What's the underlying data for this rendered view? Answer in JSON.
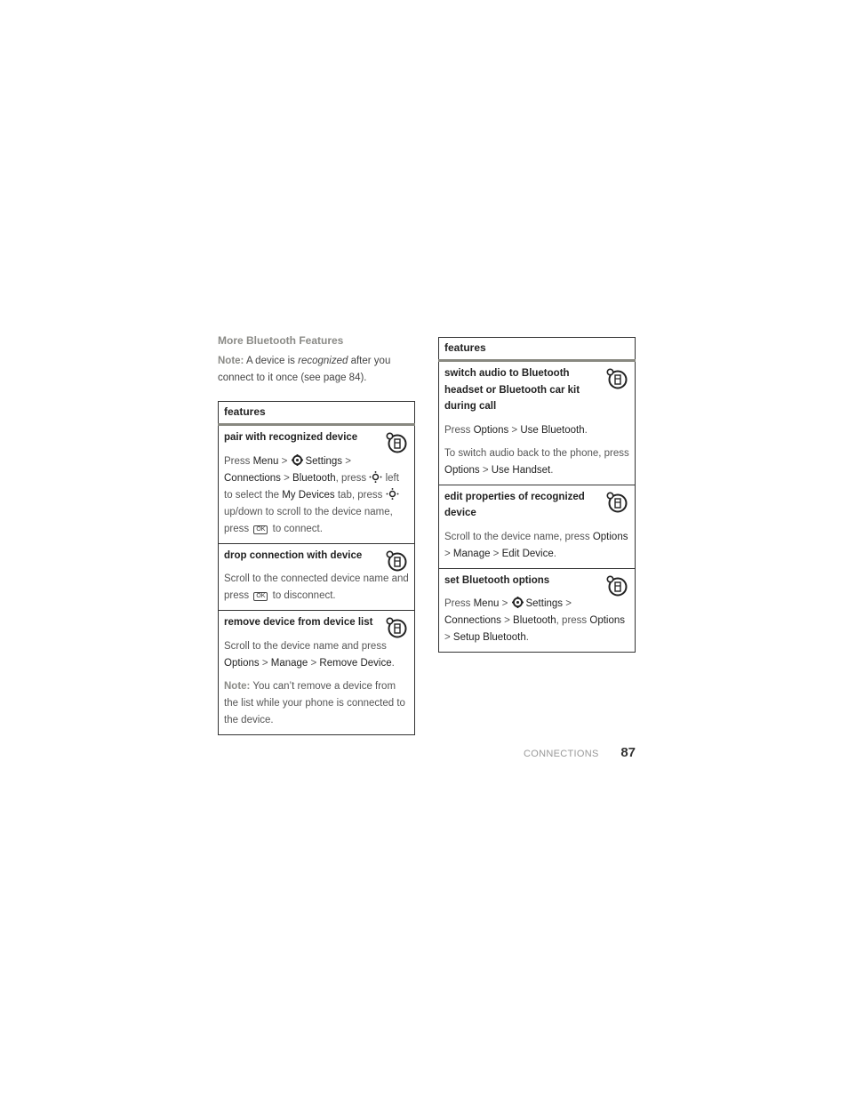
{
  "left": {
    "section_title": "More Bluetooth Features",
    "intro": {
      "note_label": "Note:",
      "text_before": " A device is ",
      "emphasis": "recognized",
      "text_after": " after you connect to it once (see page 84)."
    },
    "table_header": "features",
    "rows": [
      {
        "title": "pair with recognized device",
        "icon": "phone-feature-icon",
        "body": {
          "t1": "Press ",
          "k1": "Menu",
          "t2": " > ",
          "k2": "Settings",
          "t3": " > ",
          "k3": "Connections",
          "t4": " > ",
          "k4": "Bluetooth",
          "t5": ", press ",
          "t6": " left to select the ",
          "k5": "My Devices",
          "t7": " tab, press ",
          "t8": " up/down to scroll to the device name, press ",
          "ok": "OK",
          "t9": " to connect."
        }
      },
      {
        "title": "drop connection with device",
        "icon": "phone-feature-icon",
        "body": {
          "t1": "Scroll to the connected device name and press ",
          "ok": "OK",
          "t2": " to disconnect."
        }
      },
      {
        "title": "remove device from device list",
        "icon": "phone-feature-icon",
        "body": {
          "t1": "Scroll to the device name and press ",
          "k1": "Options",
          "t2": " > ",
          "k2": "Manage",
          "t3": " > ",
          "k3": "Remove Device",
          "t4": "."
        },
        "note": {
          "label": "Note:",
          "text": " You can’t remove a device from the list while your phone is connected to the device."
        }
      }
    ]
  },
  "right": {
    "table_header": "features",
    "rows": [
      {
        "title": "switch audio to Bluetooth headset or Bluetooth car kit during call",
        "icon": "phone-feature-icon",
        "body": {
          "t1": "Press ",
          "k1": "Options",
          "t2": " > ",
          "k2": "Use Bluetooth",
          "t3": "."
        },
        "body2": {
          "t1": "To switch audio back to the phone, press ",
          "k1": "Options",
          "t2": " > ",
          "k2": "Use Handset",
          "t3": "."
        }
      },
      {
        "title": "edit properties of recognized device",
        "icon": "phone-feature-icon",
        "body": {
          "t1": "Scroll to the device name, press ",
          "k1": "Options",
          "t2": " > ",
          "k2": "Manage",
          "t3": " > ",
          "k3": "Edit Device",
          "t4": "."
        }
      },
      {
        "title": "set Bluetooth options",
        "icon": "phone-feature-icon",
        "body": {
          "t1": "Press ",
          "k1": "Menu",
          "t2": " > ",
          "k2": "Settings",
          "t3": " > ",
          "k3": "Connections",
          "t4": " > ",
          "k4": "Bluetooth",
          "t5": ", press ",
          "k5": "Options",
          "t6": " > ",
          "k6": "Setup Bluetooth",
          "t7": "."
        }
      }
    ]
  },
  "footer": {
    "section": "CONNECTIONS",
    "page_number": "87"
  }
}
